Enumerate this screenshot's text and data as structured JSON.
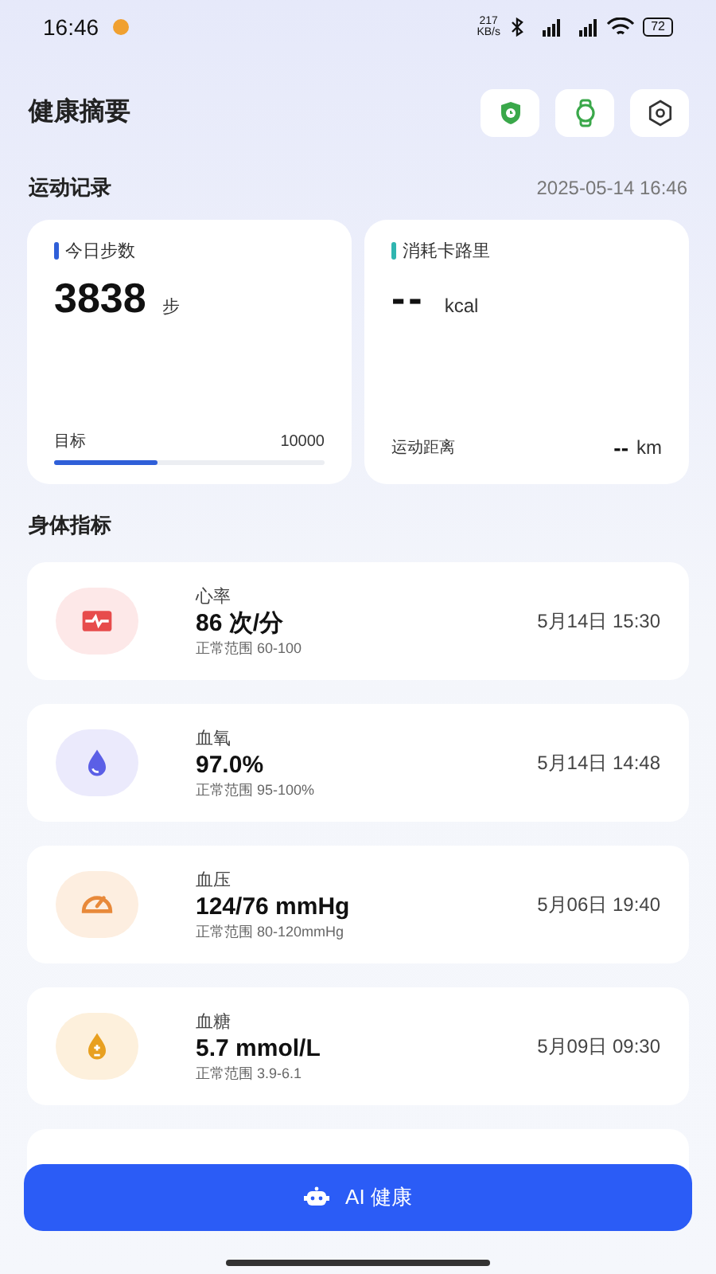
{
  "status_bar": {
    "time": "16:46",
    "net_speed": "217 KB/s",
    "battery": "72"
  },
  "header": {
    "title": "健康摘要"
  },
  "activity": {
    "title": "运动记录",
    "timestamp": "2025-05-14 16:46",
    "steps": {
      "label": "今日步数",
      "value": "3838",
      "unit": "步",
      "goal_label": "目标",
      "goal": "10000",
      "level": 0.38
    },
    "calories": {
      "label": "消耗卡路里",
      "value": "--",
      "unit": "kcal",
      "distance_label": "运动距离",
      "distance": "--",
      "distance_unit": "km"
    }
  },
  "body": {
    "title": "身体指标",
    "metrics": [
      {
        "kind": "heart",
        "name": "心率",
        "value": "86 次/分",
        "range": "正常范围 60-100",
        "time": "5月14日 15:30"
      },
      {
        "kind": "oxygen",
        "name": "血氧",
        "value": "97.0%",
        "range": "正常范围 95-100%",
        "time": "5月14日 14:48"
      },
      {
        "kind": "pressure",
        "name": "血压",
        "value": "124/76 mmHg",
        "range": "正常范围 80-120mmHg",
        "time": "5月06日 19:40"
      },
      {
        "kind": "sugar",
        "name": "血糖",
        "value": "5.7 mmol/L",
        "range": "正常范围 3.9-6.1",
        "time": "5月09日 09:30"
      }
    ]
  },
  "ai_button": {
    "label": "AI 健康"
  }
}
